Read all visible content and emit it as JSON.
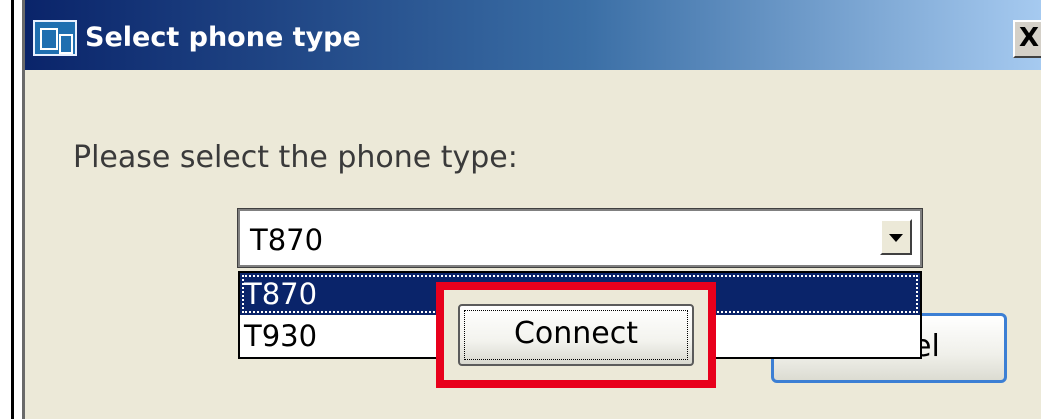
{
  "dialog": {
    "title": "Select phone type",
    "close_label": "X",
    "prompt": "Please select the phone type:"
  },
  "phone_select": {
    "selected": "T870",
    "options": [
      "T870",
      "T930"
    ]
  },
  "buttons": {
    "connect_label": "Connect",
    "cancel_label": "Cancel"
  },
  "colors": {
    "titlebar_start": "#0a246a",
    "titlebar_end": "#a6caf0",
    "selection": "#0a246a",
    "highlight_box": "#e8001c",
    "dialog_bg": "#ece9d8"
  },
  "icons": {
    "app": "phone-app-icon",
    "dropdown": "chevron-down-icon"
  }
}
